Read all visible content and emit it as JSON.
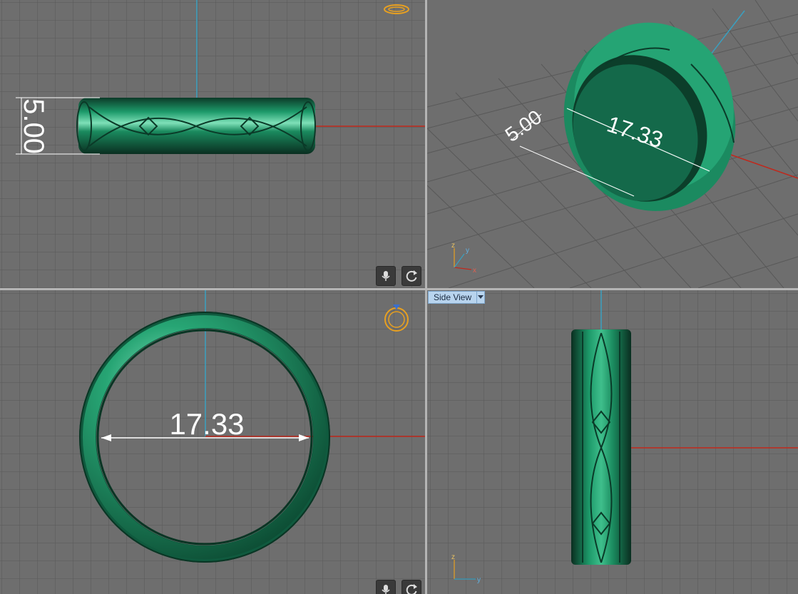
{
  "viewports": {
    "top": {
      "dimension": "5.00"
    },
    "perspective": {
      "dim_width": "5.00",
      "dim_diameter": "17.33",
      "axis_labels": {
        "x": "x",
        "y": "y",
        "z": "z"
      }
    },
    "front": {
      "dimension": "17.33"
    },
    "side": {
      "view_name": "Side View",
      "axis_labels": {
        "y": "y",
        "z": "z"
      }
    }
  },
  "controls": {
    "mic_icon": "microphone-icon",
    "rotate_icon": "rotate-icon"
  },
  "colors": {
    "viewport_bg": "#6e6e6e",
    "grid_line": "#5a5a5a",
    "ring_green": "#1b8a60",
    "axis_red": "#c0281c",
    "axis_cyan": "#3aa0c0",
    "label_bg": "#b8d4ee"
  }
}
